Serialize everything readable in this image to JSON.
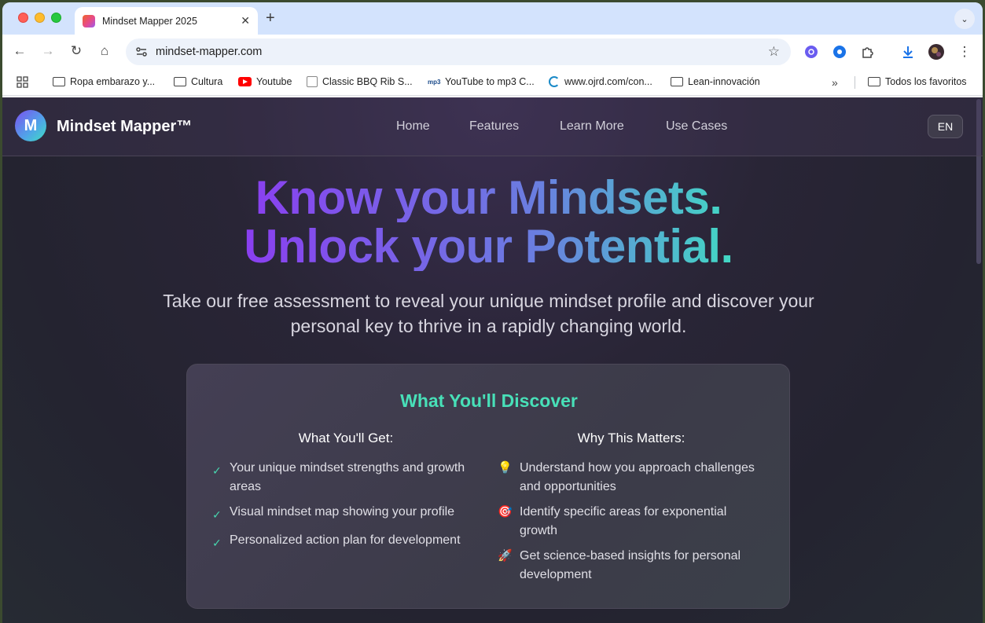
{
  "browser": {
    "tab_title": "Mindset Mapper 2025",
    "url": "mindset-mapper.com",
    "bookmarks": [
      {
        "label": "Ropa embarazo y...",
        "icon": "folder-icon"
      },
      {
        "label": "Cultura",
        "icon": "folder-icon"
      },
      {
        "label": "Youtube",
        "icon": "youtube-icon"
      },
      {
        "label": "Classic BBQ Rib S...",
        "icon": "site-icon"
      },
      {
        "label": "YouTube to mp3 C...",
        "icon": "mp3-icon"
      },
      {
        "label": "www.ojrd.com/con...",
        "icon": "loading-icon"
      },
      {
        "label": "Lean-innovación",
        "icon": "folder-icon"
      }
    ],
    "all_bookmarks_label": "Todos los favoritos"
  },
  "header": {
    "logo_letter": "M",
    "logo_text": "Mindset Mapper™",
    "nav": [
      "Home",
      "Features",
      "Learn More",
      "Use Cases"
    ],
    "lang": "EN"
  },
  "hero": {
    "line1": "Know your Mindsets.",
    "line2": "Unlock your Potential.",
    "subtitle": "Take our free assessment to reveal your unique mindset profile and discover your personal key to thrive in a rapidly changing world."
  },
  "discover": {
    "title": "What You'll Discover",
    "get_heading": "What You'll Get:",
    "get_items": [
      "Your unique mindset strengths and growth areas",
      "Visual mindset map showing your profile",
      "Personalized action plan for development"
    ],
    "why_heading": "Why This Matters:",
    "why_items": [
      {
        "emoji": "💡",
        "text": "Understand how you approach challenges and opportunities"
      },
      {
        "emoji": "🎯",
        "text": "Identify specific areas for exponential growth"
      },
      {
        "emoji": "🚀",
        "text": "Get science-based insights for personal development"
      }
    ]
  },
  "colors": {
    "accent_teal": "#48e0b8",
    "accent_purple": "#8a3ff0"
  }
}
